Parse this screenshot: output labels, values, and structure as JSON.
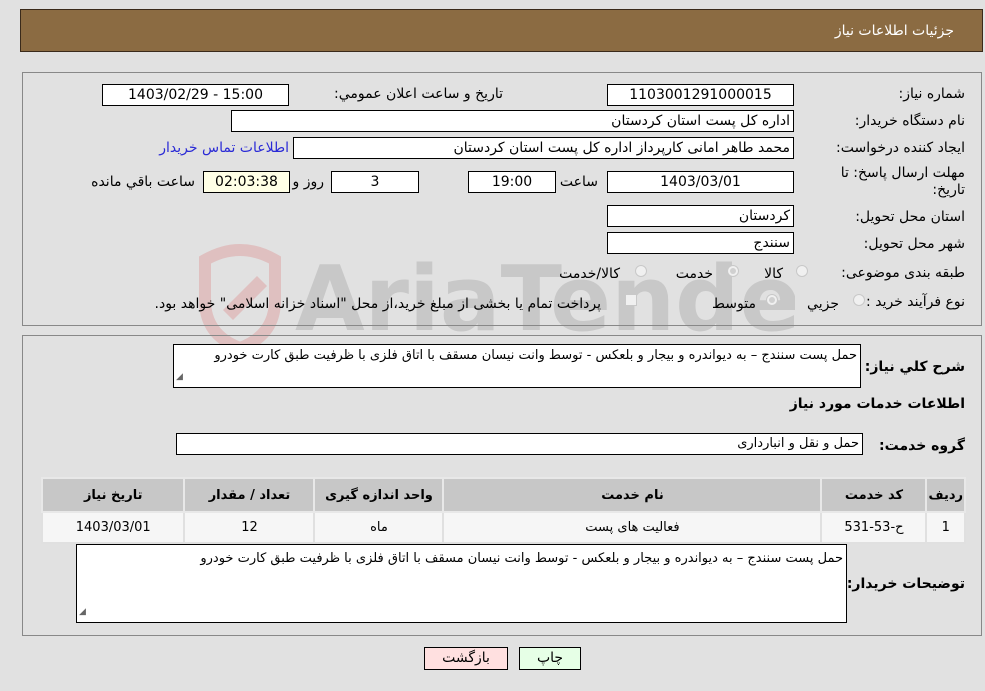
{
  "header": {
    "title": "جزئيات اطلاعات نياز"
  },
  "details": {
    "need_number_label": "شماره نياز:",
    "need_number": "1103001291000015",
    "announce_label": "تاريخ و ساعت اعلان عمومي:",
    "announce_value": "1403/02/29 - 15:00",
    "buyer_org_label": "نام دستگاه خريدار:",
    "buyer_org": "اداره کل پست استان کردستان",
    "creator_label": "ايجاد کننده درخواست:",
    "creator": "محمد طاهر امانی کارپرداز اداره کل پست استان کردستان",
    "contact_link": "اطلاعات تماس خريدار",
    "deadline_label": "مهلت ارسال پاسخ: تا تاريخ:",
    "deadline_date": "1403/03/01",
    "time_label": "ساعت",
    "deadline_time": "19:00",
    "days_value": "3",
    "days_label": "روز و",
    "remaining_time": "02:03:38",
    "remaining_label": "ساعت باقي مانده",
    "province_label": "استان محل تحويل:",
    "province": "کردستان",
    "city_label": "شهر محل تحويل:",
    "city": "سنندج",
    "category_label": "طبقه بندی موضوعی:",
    "category_options": [
      "کالا",
      "خدمت",
      "کالا/خدمت"
    ],
    "category_selected": "خدمت",
    "process_label": "نوع فرآيند خريد :",
    "process_options": [
      "جزيي",
      "متوسط"
    ],
    "process_selected": "متوسط",
    "treasury_note": "پرداخت تمام يا بخشی از مبلغ خريد،از محل \"اسناد خزانه اسلامی\" خواهد بود."
  },
  "summary": {
    "description_label": "شرح کلي نياز:",
    "description": "حمل پست سنندج – به دیواندره و  بیجار و بلعکس  - توسط  وانت نیسان  مسقف با اتاق فلزی با ظرفیت طبق کارت خودرو",
    "services_heading": "اطلاعات خدمات مورد نياز",
    "service_group_label": "گروه خدمت:",
    "service_group": "حمل و نقل و انبارداری"
  },
  "table": {
    "headers": [
      "رديف",
      "کد خدمت",
      "نام خدمت",
      "واحد اندازه گيری",
      "تعداد / مقدار",
      "تاريخ نياز"
    ],
    "rows": [
      [
        "1",
        "ح-53-531",
        "فعاليت های پست",
        "ماه",
        "12",
        "1403/03/01"
      ]
    ]
  },
  "buyer_notes": {
    "label": "توضيحات خريدار:",
    "text": "حمل پست سنندج – به دیواندره و  بیجار و بلعکس  - توسط  وانت نیسان  مسقف با اتاق فلزی با ظرفیت طبق کارت خودرو"
  },
  "buttons": {
    "print": "چاپ",
    "back": "بازگشت"
  },
  "watermark": {
    "text": "AriaTender.neT"
  }
}
